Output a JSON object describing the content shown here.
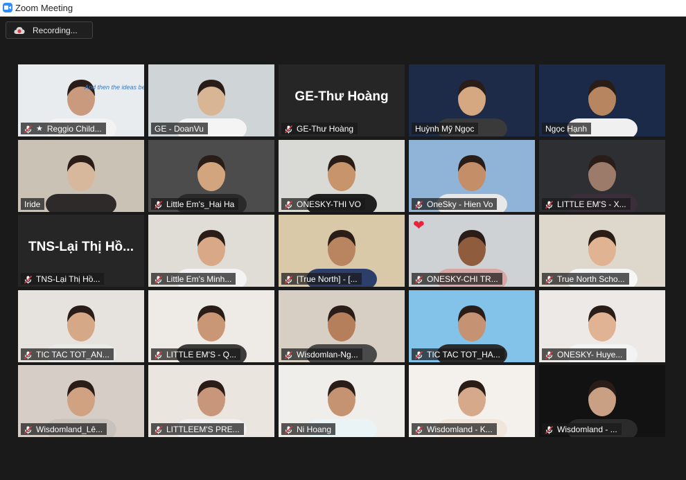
{
  "window": {
    "title": "Zoom Meeting"
  },
  "recording": {
    "label": "Recording..."
  },
  "participants": [
    {
      "name": "Reggio Child...",
      "muted": true,
      "pinned": true,
      "active": true,
      "bg": "#e9ecef",
      "skin": "#c99a7e",
      "shirt": "#f2f2f2",
      "slide": "And then the ideas beca"
    },
    {
      "name": "GE - DoanVu",
      "muted": false,
      "bg": "#cfd4d6",
      "skin": "#d8b594",
      "shirt": "#f4f4f4"
    },
    {
      "name": "GE-Thư Hoàng",
      "muted": true,
      "video_off": true,
      "display": "GE-Thư Hoàng"
    },
    {
      "name": "Huỳnh Mỹ Ngọc",
      "muted": false,
      "bg": "#1d2a48",
      "skin": "#d6a882",
      "shirt": "#3a3a3a"
    },
    {
      "name": "Ngọc Hạnh",
      "muted": false,
      "bg": "#1c2a4a",
      "skin": "#b78660",
      "shirt": "#f0f0f0"
    },
    {
      "name": "Iride",
      "muted": false,
      "bg": "#c9c2b5",
      "skin": "#d8b89c",
      "shirt": "#2f2a2a"
    },
    {
      "name": "Little Em's_Hai Ha",
      "muted": true,
      "bg": "#4c4c4c",
      "skin": "#d2a57e",
      "shirt": "#2a2a2a"
    },
    {
      "name": "ONESKY-THI VO",
      "muted": true,
      "bg": "#d9d9d6",
      "skin": "#c7946c",
      "shirt": "#1f1f1f"
    },
    {
      "name": "OneSky - Hien Vo",
      "muted": true,
      "bg": "#8fb4d8",
      "skin": "#c48f68",
      "shirt": "#e8e8e8"
    },
    {
      "name": "LITTLE EM'S - X...",
      "muted": true,
      "bg": "#2d2f33",
      "skin": "#9c7b6a",
      "shirt": "#3a2e3b"
    },
    {
      "name": "TNS-Lại Thị Hồ...",
      "muted": true,
      "video_off": true,
      "display": "TNS-Lại Thị Hồ..."
    },
    {
      "name": "Little Em's Minh...",
      "muted": true,
      "bg": "#e0ddd6",
      "skin": "#d9a987",
      "shirt": "#f3f3f3"
    },
    {
      "name": "[True North] - [...",
      "muted": true,
      "bg": "#d9c9a9",
      "skin": "#b88560",
      "shirt": "#2b3f6a"
    },
    {
      "name": "ONESKY-CHI TR...",
      "muted": true,
      "bg": "#cfd2d4",
      "skin": "#8f5d3e",
      "shirt": "#d9a6a6",
      "heart": "❤"
    },
    {
      "name": "True North Scho...",
      "muted": true,
      "bg": "#ded8cc",
      "skin": "#e0b492",
      "shirt": "#f6f6f6"
    },
    {
      "name": "TIC TAC TOT_AN...",
      "muted": true,
      "bg": "#e6e3df",
      "skin": "#d5a988",
      "shirt": "#e9e9e9"
    },
    {
      "name": "LITTLE EM'S - Q...",
      "muted": true,
      "bg": "#eeeae5",
      "skin": "#c99776",
      "shirt": "#3c3c3c"
    },
    {
      "name": "Wisdomlan-Ng...",
      "muted": true,
      "bg": "#d8cfc4",
      "skin": "#b57f5b",
      "shirt": "#4a4a4a"
    },
    {
      "name": "TIC TAC TOT_HA...",
      "muted": true,
      "bg": "#83c3ea",
      "skin": "#c59373",
      "shirt": "#2c2c2c"
    },
    {
      "name": "ONESKY- Huye...",
      "muted": true,
      "bg": "#ece9e6",
      "skin": "#dfb394",
      "shirt": "#f3f3f3"
    },
    {
      "name": "Wisdomland_Lê...",
      "muted": true,
      "bg": "#d5cdc6",
      "skin": "#d0a282",
      "shirt": "#c8c2bd"
    },
    {
      "name": "LITTLEEM'S PRE...",
      "muted": true,
      "bg": "#eae6df",
      "skin": "#c8967a",
      "shirt": "#f0f0f0"
    },
    {
      "name": "Ni Hoang",
      "muted": true,
      "bg": "#efeeea",
      "skin": "#c59372",
      "shirt": "#eaf3f6"
    },
    {
      "name": "Wisdomland - K...",
      "muted": true,
      "bg": "#f4f1ec",
      "skin": "#d6a98a",
      "shirt": "#f0e6dc"
    },
    {
      "name": "Wisdomland - ...",
      "muted": true,
      "bg": "#121212",
      "skin": "#caa084",
      "shirt": "#2b2b2b"
    }
  ]
}
